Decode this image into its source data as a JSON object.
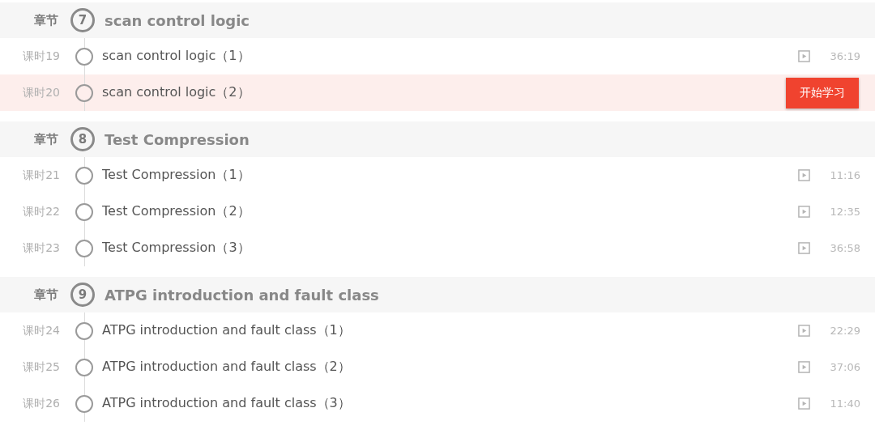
{
  "start_button": "开始学习",
  "chapters": [
    {
      "label": "章节",
      "number": "7",
      "title": "scan control logic",
      "lessons": [
        {
          "label": "课时19",
          "title": "scan control logic（1）",
          "duration": "36:19",
          "selected": false
        },
        {
          "label": "课时20",
          "title": "scan control logic（2）",
          "selected": true
        }
      ]
    },
    {
      "label": "章节",
      "number": "8",
      "title": "Test Compression",
      "lessons": [
        {
          "label": "课时21",
          "title": "Test Compression（1）",
          "duration": "11:16",
          "selected": false
        },
        {
          "label": "课时22",
          "title": "Test Compression（2）",
          "duration": "12:35",
          "selected": false
        },
        {
          "label": "课时23",
          "title": "Test Compression（3）",
          "duration": "36:58",
          "selected": false
        }
      ]
    },
    {
      "label": "章节",
      "number": "9",
      "title": "ATPG introduction and fault class",
      "lessons": [
        {
          "label": "课时24",
          "title": "ATPG introduction and fault class（1）",
          "duration": "22:29",
          "selected": false
        },
        {
          "label": "课时25",
          "title": "ATPG introduction and fault class（2）",
          "duration": "37:06",
          "selected": false
        },
        {
          "label": "课时26",
          "title": "ATPG introduction and fault class（3）",
          "duration": "11:40",
          "selected": false
        }
      ]
    }
  ]
}
